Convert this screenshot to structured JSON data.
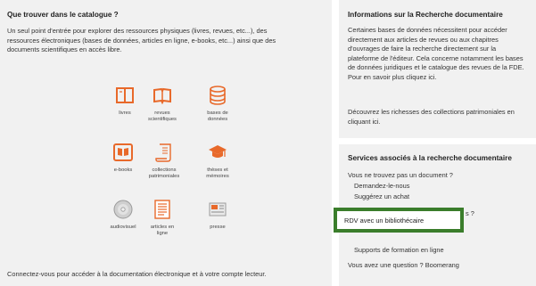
{
  "catalogue": {
    "title": "Que trouver dans le catalogue ?",
    "intro": [
      "Un seul point d'entrée pour explorer des ressources physiques (livres, revues, etc...), des",
      "ressources électroniques (bases de données, articles en ligne, e-books, etc...) ainsi que des",
      "documents scientifiques en accès libre."
    ],
    "tiles": [
      {
        "icon": "book-icon",
        "label": [
          "livres"
        ]
      },
      {
        "icon": "open-magazine-icon",
        "label": [
          "revues",
          "scientifiques"
        ]
      },
      {
        "icon": "database-icon",
        "label": [
          "bases de",
          "données"
        ]
      },
      {
        "icon": "ebook-reader-icon",
        "label": [
          "e-books"
        ]
      },
      {
        "icon": "scroll-icon",
        "label": [
          "collections",
          "patrimoniales"
        ]
      },
      {
        "icon": "graduation-cap-icon",
        "label": [
          "thèses et",
          "mémoires"
        ]
      },
      {
        "icon": "disc-icon",
        "label": [
          "audiovisuel"
        ]
      },
      {
        "icon": "article-icon",
        "label": [
          "articles en",
          "ligne"
        ]
      },
      {
        "icon": "newspaper-icon",
        "label": [
          "presse"
        ]
      }
    ],
    "footer": "Connectez-vous pour accéder à la documentation électronique et à votre compte lecteur.",
    "accent_color": "#e8692a"
  },
  "info": {
    "title": "Informations sur la Recherche documentaire",
    "paragraph1": [
      "Certaines bases de données nécessitent pour accéder",
      "directement aux articles de revues ou aux chapitres",
      "d'ouvrages de faire la recherche directement sur la",
      "plateforme de l'éditeur. Cela concerne notamment les bases",
      "de données juridiques et le catalogue des revues de la FDE.",
      "Pour en savoir plus cliquez ici."
    ],
    "paragraph2": [
      "Découvrez les richesses des collections patrimoniales en",
      "cliquant ici."
    ]
  },
  "services": {
    "title": "Services associés à la recherche documentaire",
    "question": "Vous ne trouvez pas un document ?",
    "ask_link": "Demandez-le-nous",
    "suggest_link": "Suggérez un achat",
    "hidden_fragment": "s ?",
    "rdv_label": "RDV avec un bibliothécaire",
    "training_link": "Supports de formation en ligne",
    "boomerang_link": "Vous avez une question ? Boomerang",
    "highlight_color": "#3a7d2b"
  }
}
